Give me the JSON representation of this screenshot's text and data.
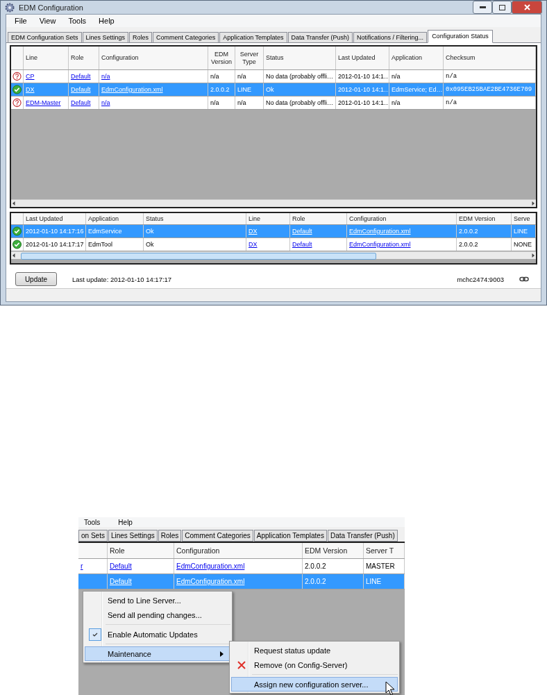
{
  "window": {
    "title": "EDM Configuration"
  },
  "menu": [
    "File",
    "View",
    "Tools",
    "Help"
  ],
  "tabs": [
    {
      "label": "EDM Configuration Sets",
      "selected": false
    },
    {
      "label": "Lines Settings",
      "selected": false
    },
    {
      "label": "Roles",
      "selected": false
    },
    {
      "label": "Comment Categories",
      "selected": false
    },
    {
      "label": "Application Templates",
      "selected": false
    },
    {
      "label": "Data Transfer (Push)",
      "selected": false
    },
    {
      "label": "Notifications / Filtering...",
      "selected": false
    },
    {
      "label": "Configuration Status",
      "selected": true
    }
  ],
  "status_grid": {
    "columns": [
      "Line",
      "Role",
      "Configuration",
      "EDM Version",
      "Server Type",
      "Status",
      "Last Updated",
      "Application",
      "Checksum"
    ],
    "rows": [
      {
        "kind": "unknown",
        "selected": false,
        "cells": [
          {
            "text": "CP",
            "link": true
          },
          {
            "text": "Default",
            "link": true
          },
          {
            "text": "n/a",
            "link": true
          },
          {
            "text": "n/a"
          },
          {
            "text": "n/a"
          },
          {
            "text": "No data (probably offli…"
          },
          {
            "text": "2012-01-10 14:1…"
          },
          {
            "text": "n/a"
          },
          {
            "text": "n/a",
            "mono": true
          }
        ]
      },
      {
        "kind": "ok",
        "selected": true,
        "cells": [
          {
            "text": "DX",
            "link": true
          },
          {
            "text": "Default",
            "link": true
          },
          {
            "text": "EdmConfiguration.xml",
            "link": true
          },
          {
            "text": "2.0.0.2"
          },
          {
            "text": "LINE"
          },
          {
            "text": "Ok"
          },
          {
            "text": "2012-01-10 14:1…"
          },
          {
            "text": "EdmService; Ed…"
          },
          {
            "text": "0x095EB25BAE2BE4736E709",
            "mono": true
          }
        ]
      },
      {
        "kind": "unknown",
        "selected": false,
        "cells": [
          {
            "text": "EDM-Master",
            "link": true
          },
          {
            "text": "Default",
            "link": true
          },
          {
            "text": "n/a",
            "link": true
          },
          {
            "text": "n/a"
          },
          {
            "text": "n/a"
          },
          {
            "text": "No data (probably offli…"
          },
          {
            "text": "2012-01-10 14:1…"
          },
          {
            "text": "n/a"
          },
          {
            "text": "n/a",
            "mono": true
          }
        ]
      }
    ]
  },
  "history_grid": {
    "columns": [
      "Last Updated",
      "Application",
      "Status",
      "Line",
      "Role",
      "Configuration",
      "EDM Version",
      "Serve"
    ],
    "rows": [
      {
        "kind": "ok",
        "selected": true,
        "cells": [
          {
            "text": "2012-01-10 14:17:16"
          },
          {
            "text": "EdmService"
          },
          {
            "text": "Ok"
          },
          {
            "text": "DX",
            "link": true
          },
          {
            "text": "Default",
            "link": true
          },
          {
            "text": "EdmConfiguration.xml",
            "link": true
          },
          {
            "text": "2.0.0.2"
          },
          {
            "text": "LINE"
          }
        ]
      },
      {
        "kind": "ok",
        "selected": false,
        "cells": [
          {
            "text": "2012-01-10 14:17:17"
          },
          {
            "text": "EdmTool"
          },
          {
            "text": "Ok"
          },
          {
            "text": "DX",
            "link": true
          },
          {
            "text": "Default",
            "link": true
          },
          {
            "text": "EdmConfiguration.xml",
            "link": true
          },
          {
            "text": "2.0.0.2"
          },
          {
            "text": "NONE"
          }
        ]
      }
    ]
  },
  "footer": {
    "update_button": "Update",
    "last_update": "Last update: 2012-01-10 14:17:17",
    "server": "mchc2474:9003"
  },
  "inset": {
    "menu": [
      "Tools",
      "Help"
    ],
    "tabs": [
      "on Sets",
      "Lines Settings",
      "Roles",
      "Comment Categories",
      "Application Templates",
      "Data Transfer (Push)"
    ],
    "columns": [
      "Role",
      "Configuration",
      "EDM Version",
      "Server T"
    ],
    "rows": [
      {
        "selected": false,
        "line": {
          "text": "r",
          "link": true
        },
        "cells": [
          {
            "text": "Default",
            "link": true
          },
          {
            "text": "EdmConfiguration.xml",
            "link": true
          },
          {
            "text": "2.0.0.2"
          },
          {
            "text": "MASTER"
          }
        ]
      },
      {
        "selected": true,
        "cells": [
          {
            "text": "Default",
            "link": true
          },
          {
            "text": "EdmConfiguration.xml",
            "link": true
          },
          {
            "text": "2.0.0.2"
          },
          {
            "text": "LINE"
          }
        ]
      }
    ],
    "context_menu": [
      {
        "kind": "item",
        "label": "Send to Line Server...",
        "selected": false
      },
      {
        "kind": "item",
        "label": "Send all pending changes...",
        "selected": false
      },
      {
        "kind": "separator"
      },
      {
        "kind": "check",
        "label": "Enable Automatic Updates",
        "checked": true,
        "selected": false
      },
      {
        "kind": "separator"
      },
      {
        "kind": "submenu",
        "label": "Maintenance",
        "selected": true
      }
    ],
    "submenu": [
      {
        "kind": "item",
        "label": "Request status update",
        "selected": false
      },
      {
        "kind": "delete",
        "label": "Remove (on Config-Server)",
        "selected": false
      },
      {
        "kind": "separator"
      },
      {
        "kind": "item",
        "label": "Assign new configuration server...",
        "selected": true
      }
    ]
  }
}
